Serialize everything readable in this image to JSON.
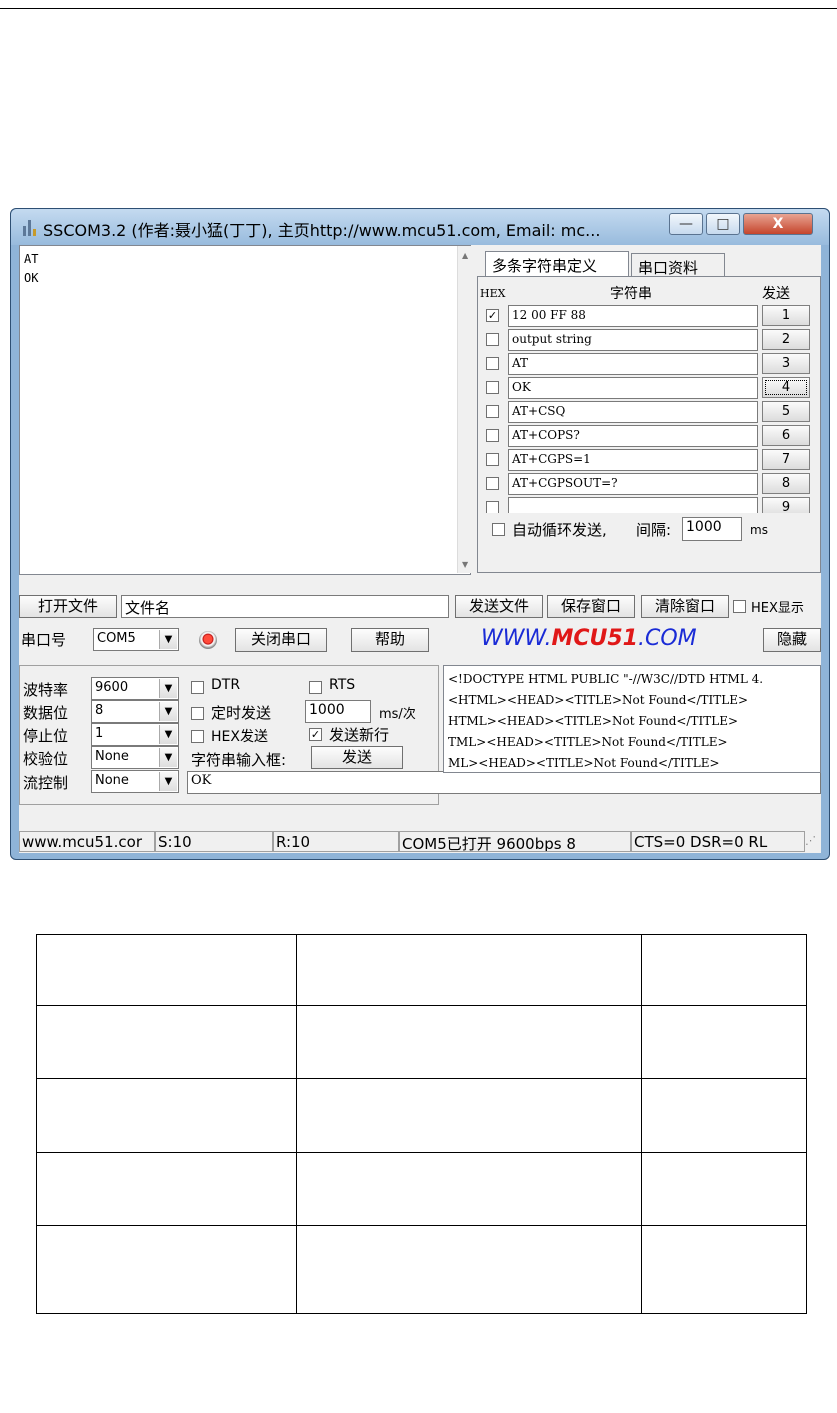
{
  "window": {
    "title": "SSCOM3.2 (作者:聂小猛(丁丁), 主页http://www.mcu51.com,  Email: mc...",
    "controls": {
      "minimize": "—",
      "maximize": "□",
      "close": "X"
    }
  },
  "receive_area": {
    "lines": [
      "AT",
      "OK"
    ]
  },
  "tabs": [
    {
      "label": "多条字符串定义"
    },
    {
      "label": "串口资料"
    }
  ],
  "multi_string": {
    "header": {
      "hex": "HEX",
      "string": "字符串",
      "send": "发送"
    },
    "rows": [
      {
        "hex": true,
        "value": "12 00 FF 88",
        "button": "1"
      },
      {
        "hex": false,
        "value": "output string",
        "button": "2"
      },
      {
        "hex": false,
        "value": "AT",
        "button": "3"
      },
      {
        "hex": false,
        "value": "OK",
        "button": "4"
      },
      {
        "hex": false,
        "value": "AT+CSQ",
        "button": "5"
      },
      {
        "hex": false,
        "value": "AT+COPS?",
        "button": "6"
      },
      {
        "hex": false,
        "value": "AT+CGPS=1",
        "button": "7"
      },
      {
        "hex": false,
        "value": "AT+CGPSOUT=?",
        "button": "8"
      },
      {
        "hex": false,
        "value": "",
        "button": "9"
      }
    ],
    "loop_send_label": "自动循环发送,",
    "interval_label": "间隔:",
    "interval_value": "1000",
    "interval_unit": "ms"
  },
  "file_row": {
    "open_file": "打开文件",
    "filename": "文件名",
    "send_file": "发送文件",
    "save_window": "保存窗口",
    "clear_window": "清除窗口",
    "hex_display": "HEX显示"
  },
  "port_row": {
    "port_label": "串口号",
    "port_value": "COM5",
    "close_port": "关闭串口",
    "help": "帮助",
    "logo_prefix": "WWW.",
    "logo_mid": "MCU51",
    "logo_suffix": ".COM",
    "hide": "隐藏"
  },
  "settings": {
    "baud_label": "波特率",
    "baud_value": "9600",
    "databits_label": "数据位",
    "databits_value": "8",
    "stopbits_label": "停止位",
    "stopbits_value": "1",
    "parity_label": "校验位",
    "parity_value": "None",
    "flow_label": "流控制",
    "flow_value": "None"
  },
  "options": {
    "dtr": "DTR",
    "rts": "RTS",
    "timed_send": "定时发送",
    "timed_value": "1000",
    "timed_unit": "ms/次",
    "hex_send": "HEX发送",
    "send_newline": "发送新行",
    "input_label": "字符串输入框:",
    "send_button": "发送",
    "input_value": "OK"
  },
  "html_log": [
    "<!DOCTYPE HTML PUBLIC \"-//W3C//DTD HTML 4.",
    "<HTML><HEAD><TITLE>Not Found</TITLE>",
    "HTML><HEAD><TITLE>Not Found</TITLE>",
    "TML><HEAD><TITLE>Not Found</TITLE>",
    "ML><HEAD><TITLE>Not Found</TITLE>"
  ],
  "status_bar": {
    "site": "www.mcu51.cor",
    "sent": "S:10",
    "received": "R:10",
    "port_status": "COM5已打开  9600bps  8",
    "signals": "CTS=0 DSR=0 RL"
  },
  "colors": {
    "title_bar": "#a9c8e8",
    "close_button": "#c5452c",
    "logo_blue": "#1a2bd6",
    "logo_red": "#e01818"
  }
}
